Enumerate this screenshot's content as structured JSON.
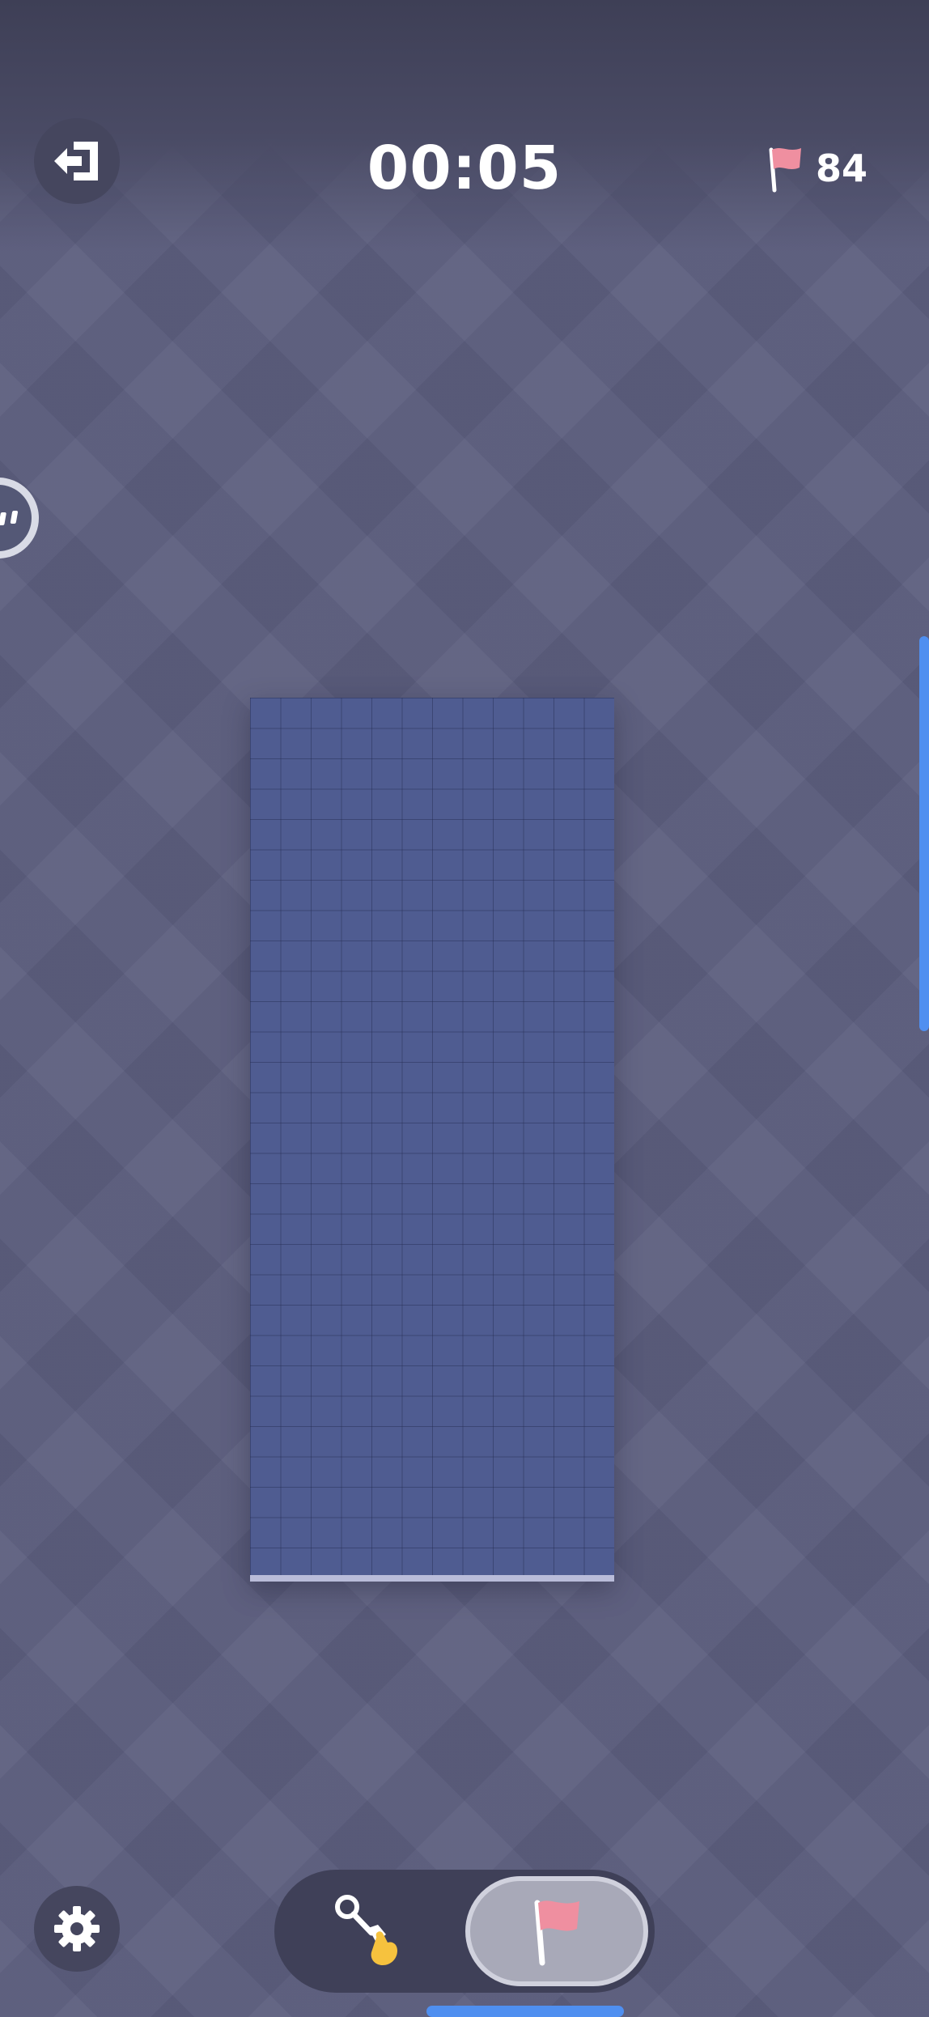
{
  "header": {
    "exit_icon": "exit-door-arrow-icon",
    "timer": "00:05",
    "flag_icon": "red-flag-icon",
    "flags_remaining": "84"
  },
  "board": {
    "columns": 12,
    "rows": 29,
    "state": "all cells covered"
  },
  "controls": {
    "settings_icon": "gear-icon",
    "mode_dig_icon": "shovel-hand-icon",
    "mode_flag_icon": "red-flag-icon",
    "selected_mode": "flag"
  },
  "colors": {
    "background": "#5c5e7e",
    "board_cell": "#4f5c91",
    "flag": "#ef8fa0",
    "scrollbar": "#4f8ff0"
  }
}
